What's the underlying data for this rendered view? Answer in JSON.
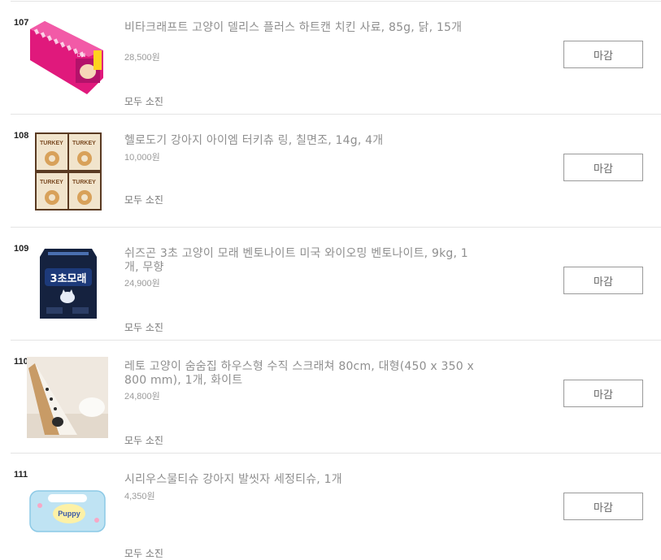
{
  "products": [
    {
      "rank": "107",
      "title": "비타크래프트 고양이 델리스 플러스 하트캔 치킨 사료, 85g, 닭, 15개",
      "price": "28,500원",
      "status": "모두 소진",
      "button_label": "마감",
      "image_icon": "cat-food-cans-pack-icon"
    },
    {
      "rank": "108",
      "title": "헬로도기 강아지 아이엠 터키츄 링, 칠면조, 14g, 4개",
      "price": "10,000원",
      "status": "모두 소진",
      "button_label": "마감",
      "image_icon": "turkey-chew-packs-icon"
    },
    {
      "rank": "109",
      "title": "쉬즈곤 3초 고양이 모래 벤토나이트 미국 와이오밍 벤토나이트, 9kg, 1개, 무향",
      "price": "24,900원",
      "status": "모두 소진",
      "button_label": "마감",
      "image_icon": "cat-litter-bag-icon",
      "image_text": "3초모래"
    },
    {
      "rank": "110",
      "title": "레토 고양이 숨숨집 하우스형 수직 스크래쳐 80cm, 대형(450 x 350 x 800 mm), 1개, 화이트",
      "price": "24,800원",
      "status": "모두 소진",
      "button_label": "마감",
      "image_icon": "cat-scratcher-house-icon"
    },
    {
      "rank": "111",
      "title": "시리우스물티슈 강아지 발씻자 세정티슈, 1개",
      "price": "4,350원",
      "status": "모두 소진",
      "button_label": "마감",
      "image_icon": "wet-tissue-pack-icon",
      "image_text": "Puppy"
    }
  ],
  "colors": {
    "title_text": "#8f8f8f",
    "rank_text": "#222222",
    "divider": "#e4e4e4",
    "button_border": "#9a9a9a"
  }
}
